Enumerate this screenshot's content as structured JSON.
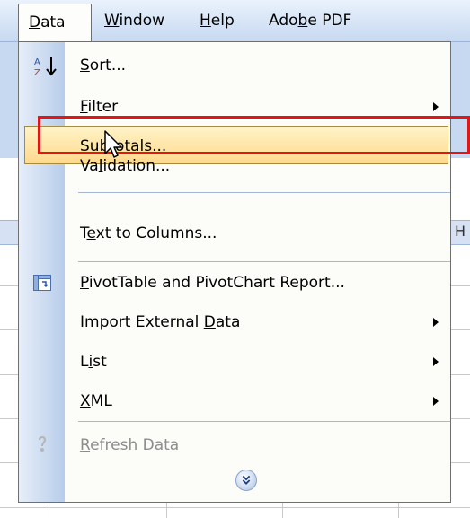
{
  "menubar": {
    "items": [
      {
        "pre": "",
        "u": "D",
        "post": "ata"
      },
      {
        "pre": "",
        "u": "W",
        "post": "indow"
      },
      {
        "pre": "",
        "u": "H",
        "post": "elp"
      },
      {
        "pre": "Ado",
        "u": "b",
        "post": "e PDF"
      }
    ]
  },
  "background": {
    "column_letter": "H"
  },
  "menu": {
    "items": [
      {
        "pre": "",
        "u": "S",
        "post": "ort...",
        "icon": "sort-ascending-icon",
        "submenu": false,
        "enabled": true
      },
      {
        "pre": "",
        "u": "F",
        "post": "ilter",
        "icon": "",
        "submenu": true,
        "enabled": true
      },
      {
        "pre": "Su",
        "u": "b",
        "post": "totals...",
        "icon": "",
        "submenu": false,
        "enabled": true,
        "highlighted": true
      },
      {
        "pre": "Va",
        "u": "l",
        "post": "idation...",
        "icon": "",
        "submenu": false,
        "enabled": true
      },
      {
        "pre": "T",
        "u": "e",
        "post": "xt to Columns...",
        "icon": "",
        "submenu": false,
        "enabled": true
      },
      {
        "pre": "",
        "u": "P",
        "post": "ivotTable and PivotChart Report...",
        "icon": "pivottable-icon",
        "submenu": false,
        "enabled": true
      },
      {
        "pre": "Import External ",
        "u": "D",
        "post": "ata",
        "icon": "",
        "submenu": true,
        "enabled": true
      },
      {
        "pre": "L",
        "u": "i",
        "post": "st",
        "icon": "",
        "submenu": true,
        "enabled": true
      },
      {
        "pre": "",
        "u": "X",
        "post": "ML",
        "icon": "",
        "submenu": true,
        "enabled": true
      },
      {
        "pre": "",
        "u": "R",
        "post": "efresh Data",
        "icon": "refresh-data-icon",
        "submenu": false,
        "enabled": false
      }
    ],
    "expand_icon": "double-chevron-down-icon"
  },
  "colors": {
    "highlight_border": "#a88a3d",
    "annotation": "#e41515",
    "gutter": "#b8cdea"
  }
}
